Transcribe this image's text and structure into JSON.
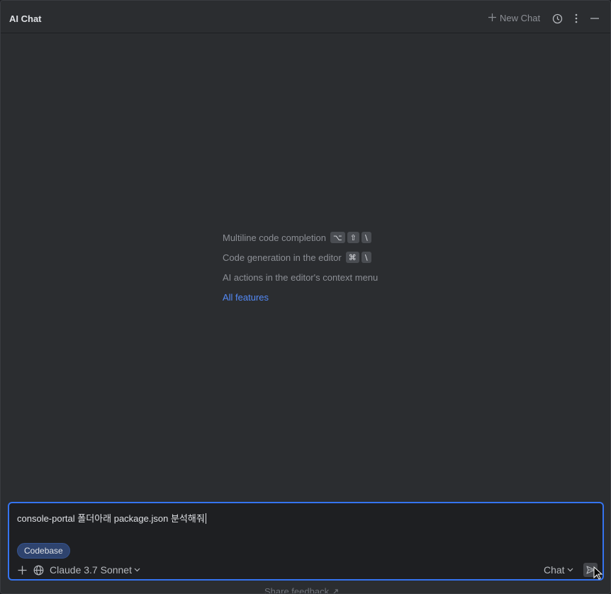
{
  "header": {
    "title": "AI Chat",
    "new_chat_label": "New Chat",
    "icons": [
      "history-icon",
      "more-icon",
      "minimize-icon"
    ]
  },
  "tips": {
    "items": [
      {
        "label": "Multiline code completion",
        "keys": [
          "⌥",
          "⇧",
          "\\"
        ]
      },
      {
        "label": "Code generation in the editor",
        "keys": [
          "⌘",
          "\\"
        ]
      },
      {
        "label": "AI actions in the editor's context menu",
        "keys": []
      }
    ],
    "all_features_link": "All features"
  },
  "input": {
    "value": "console-portal 폴더아래 package.json 분석해줘",
    "context_chip": "Codebase",
    "model": "Claude 3.7 Sonnet",
    "mode": "Chat"
  },
  "footer": {
    "feedback_label": "Share feedback ↗"
  },
  "colors": {
    "accent": "#3574f0",
    "link": "#548af7",
    "background": "#2b2d30"
  }
}
